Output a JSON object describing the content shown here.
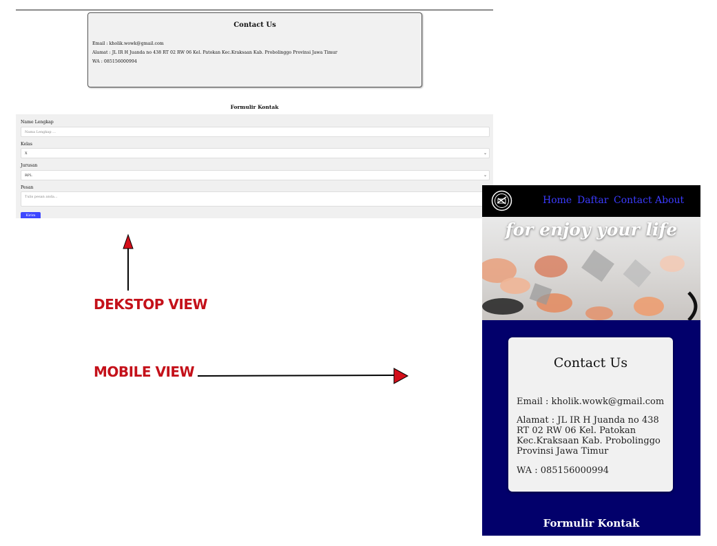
{
  "desktop": {
    "contact": {
      "title": "Contact Us",
      "email": "Email : kholik.wowk@gmail.com",
      "alamat": "Alamat : JL IR H Juanda no 438 RT 02 RW 06 Kel. Patokan Kec.Kraksaan Kab. Probolinggo Provinsi Jawa Timur",
      "wa": "WA : 085156000994"
    },
    "form": {
      "title": "Formulir Kontak",
      "name_label": "Name Lengkap",
      "name_placeholder": "Nama Lengkap ...",
      "kelas_label": "Kelas",
      "kelas_value": "X",
      "jurusan_label": "Jurusan",
      "jurusan_value": "RPL",
      "pesan_label": "Pesan",
      "pesan_placeholder": "Tulis pesan anda...",
      "submit_label": "Kirim"
    }
  },
  "annotations": {
    "desktop_label": "DEKSTOP VIEW",
    "mobile_label": "MOBILE VIEW",
    "color": "#c4111a"
  },
  "mobile": {
    "nav": {
      "items": [
        "Home",
        "Daftar",
        "Contact",
        "About"
      ],
      "link_color": "#3b3bff",
      "logo_icon": "sushi-logo-icon"
    },
    "hero": {
      "tagline": "for enjoy your life"
    },
    "contact": {
      "title": "Contact Us",
      "email": "Email : kholik.wowk@gmail.com",
      "alamat": "Alamat : JL IR H Juanda no 438 RT 02 RW 06 Kel. Patokan Kec.Kraksaan Kab. Probolinggo Provinsi Jawa Timur",
      "wa": "WA : 085156000994"
    },
    "form_title": "Formulir Kontak",
    "background": "#02006b"
  }
}
